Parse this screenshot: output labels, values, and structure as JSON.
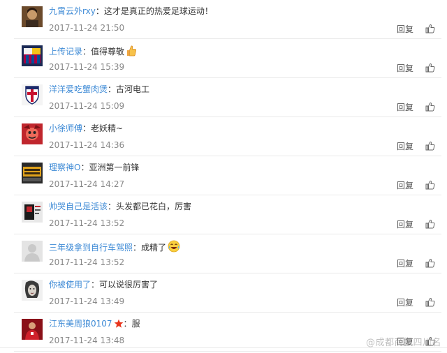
{
  "comments": [
    {
      "user": "九霄云外rxy",
      "text": "这才是真正的热爱足球运动！",
      "time": "2017-11-24 21:50",
      "reply": "回复",
      "avatar": "portrait-avatar",
      "emoji": null
    },
    {
      "user": "上传记录",
      "text": "值得尊敬",
      "time": "2017-11-24 15:39",
      "reply": "回复",
      "avatar": "barcelona-crest-avatar",
      "emoji": "thumbs-up-emoji"
    },
    {
      "user": "洋洋爱吃蟹肉煲",
      "text": "古河电工",
      "time": "2017-11-24 15:09",
      "reply": "回复",
      "avatar": "england-crest-avatar",
      "emoji": null
    },
    {
      "user": "小徐师傅",
      "text": "老妖精~",
      "time": "2017-11-24 14:36",
      "reply": "回复",
      "avatar": "red-cartoon-avatar",
      "emoji": null
    },
    {
      "user": "理察神O",
      "text": "亚洲第一前锋",
      "time": "2017-11-24 14:27",
      "reply": "回复",
      "avatar": "badge-avatar",
      "emoji": null
    },
    {
      "user": "帅哭自己是活该",
      "text": "头发都已花白，厉害",
      "time": "2017-11-24 13:52",
      "reply": "回复",
      "avatar": "poster-avatar",
      "emoji": null
    },
    {
      "user": "三年级拿到自行车驾照",
      "text": "成精了",
      "time": "2017-11-24 13:52",
      "reply": "回复",
      "avatar": "default-avatar",
      "emoji": "laughing-emoji"
    },
    {
      "user": "你被使用了",
      "text": "可以说很厉害了",
      "time": "2017-11-24 13:49",
      "reply": "回复",
      "avatar": "sketch-face-avatar",
      "emoji": null
    },
    {
      "user": "江东美周狼0107",
      "text": "服",
      "time": "2017-11-24 13:48",
      "reply": "回复",
      "avatar": "red-team-avatar",
      "emoji": "star-badge"
    }
  ],
  "separator": "：",
  "watermark": "@成都商报四川名"
}
